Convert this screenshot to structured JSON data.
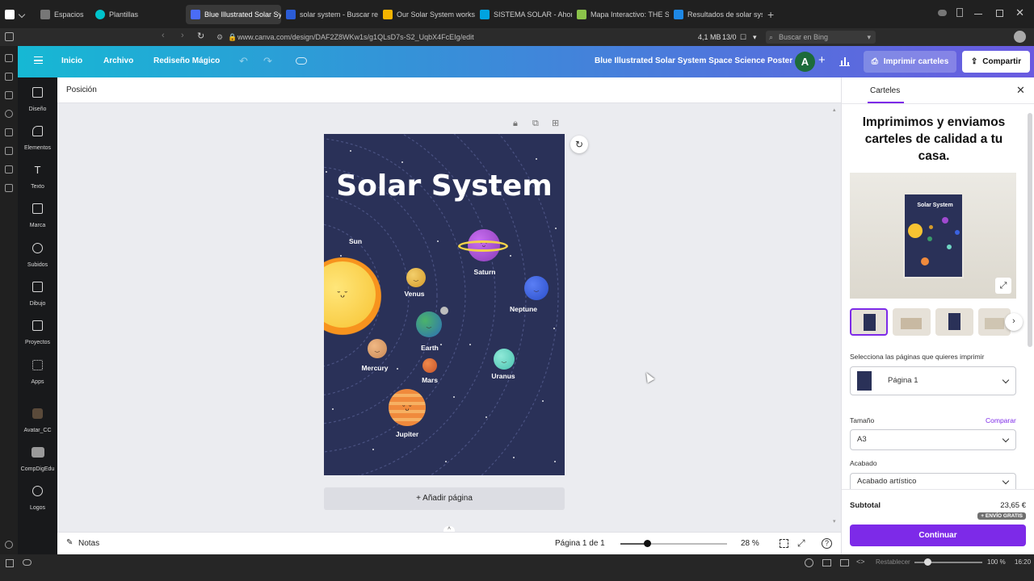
{
  "browser": {
    "workspaces_label": "Espacios",
    "tabs": [
      {
        "label": "Plantillas",
        "color": "#00c4cc"
      },
      {
        "label": "Blue Illustrated Solar Syster",
        "color": "#4a6cf7",
        "active": true
      },
      {
        "label": "solar system - Buscar result",
        "color": "#2b5cd6"
      },
      {
        "label": "Our Solar System workshee",
        "color": "#f4b400"
      },
      {
        "label": "SISTEMA SOLAR - Ahorcad",
        "color": "#00a3e0"
      },
      {
        "label": "Mapa Interactivo: THE SOLA",
        "color": "#8bc34a"
      },
      {
        "label": "Resultados de solar system",
        "color": "#1e88e5"
      }
    ],
    "url": "www.canva.com/design/DAF2Z8WKw1s/g1QLsD7s-S2_UqbX4FcEIg/edit",
    "memory": "4,1 MB",
    "counter": "13/0",
    "search_placeholder": "Buscar en Bing"
  },
  "header": {
    "menu": [
      "Inicio",
      "Archivo",
      "Rediseño Mágico"
    ],
    "doc_title": "Blue Illustrated Solar System Space Science Poster",
    "avatar_letter": "A",
    "print_button": "Imprimir carteles",
    "share_button": "Compartir"
  },
  "sidebar": {
    "items": [
      {
        "label": "Diseño",
        "icon": "layout-icon"
      },
      {
        "label": "Elementos",
        "icon": "shapes-icon"
      },
      {
        "label": "Texto",
        "icon": "text-icon"
      },
      {
        "label": "Marca",
        "icon": "brand-icon"
      },
      {
        "label": "Subidos",
        "icon": "upload-icon"
      },
      {
        "label": "Dibujo",
        "icon": "pen-icon"
      },
      {
        "label": "Proyectos",
        "icon": "folder-icon"
      },
      {
        "label": "Apps",
        "icon": "grid-icon"
      },
      {
        "label": "Avatar_CC",
        "icon": "avatar-app-icon"
      },
      {
        "label": "CompDigEdu",
        "icon": "app-icon"
      },
      {
        "label": "Logos",
        "icon": "logo-app-icon"
      }
    ]
  },
  "editor": {
    "position_label": "Posición",
    "poster": {
      "title": "Solar System",
      "planets": [
        "Sun",
        "Venus",
        "Saturn",
        "Neptune",
        "Earth",
        "Mercury",
        "Mars",
        "Uranus",
        "Jupiter"
      ]
    },
    "add_page": "+ Añadir página",
    "notes": "Notas",
    "page_indicator": "Página 1 de 1",
    "zoom": "28 %"
  },
  "panel": {
    "tab": "Carteles",
    "heading": "Imprimimos y enviamos carteles de calidad a tu casa.",
    "preview_title": "Solar System",
    "select_pages_label": "Selecciona las páginas que quieres imprimir",
    "page_selected": "Página 1",
    "size_label": "Tamaño",
    "compare_link": "Comparar",
    "size_value": "A3",
    "finish_label": "Acabado",
    "finish_value": "Acabado artístico",
    "subtotal_label": "Subtotal",
    "subtotal_value": "23,65 €",
    "free_shipping": "+ ENVÍO GRATIS",
    "continue_button": "Continuar"
  },
  "taskbar": {
    "reset_label": "Restablecer",
    "zoom": "100 %",
    "time": "16:20"
  }
}
